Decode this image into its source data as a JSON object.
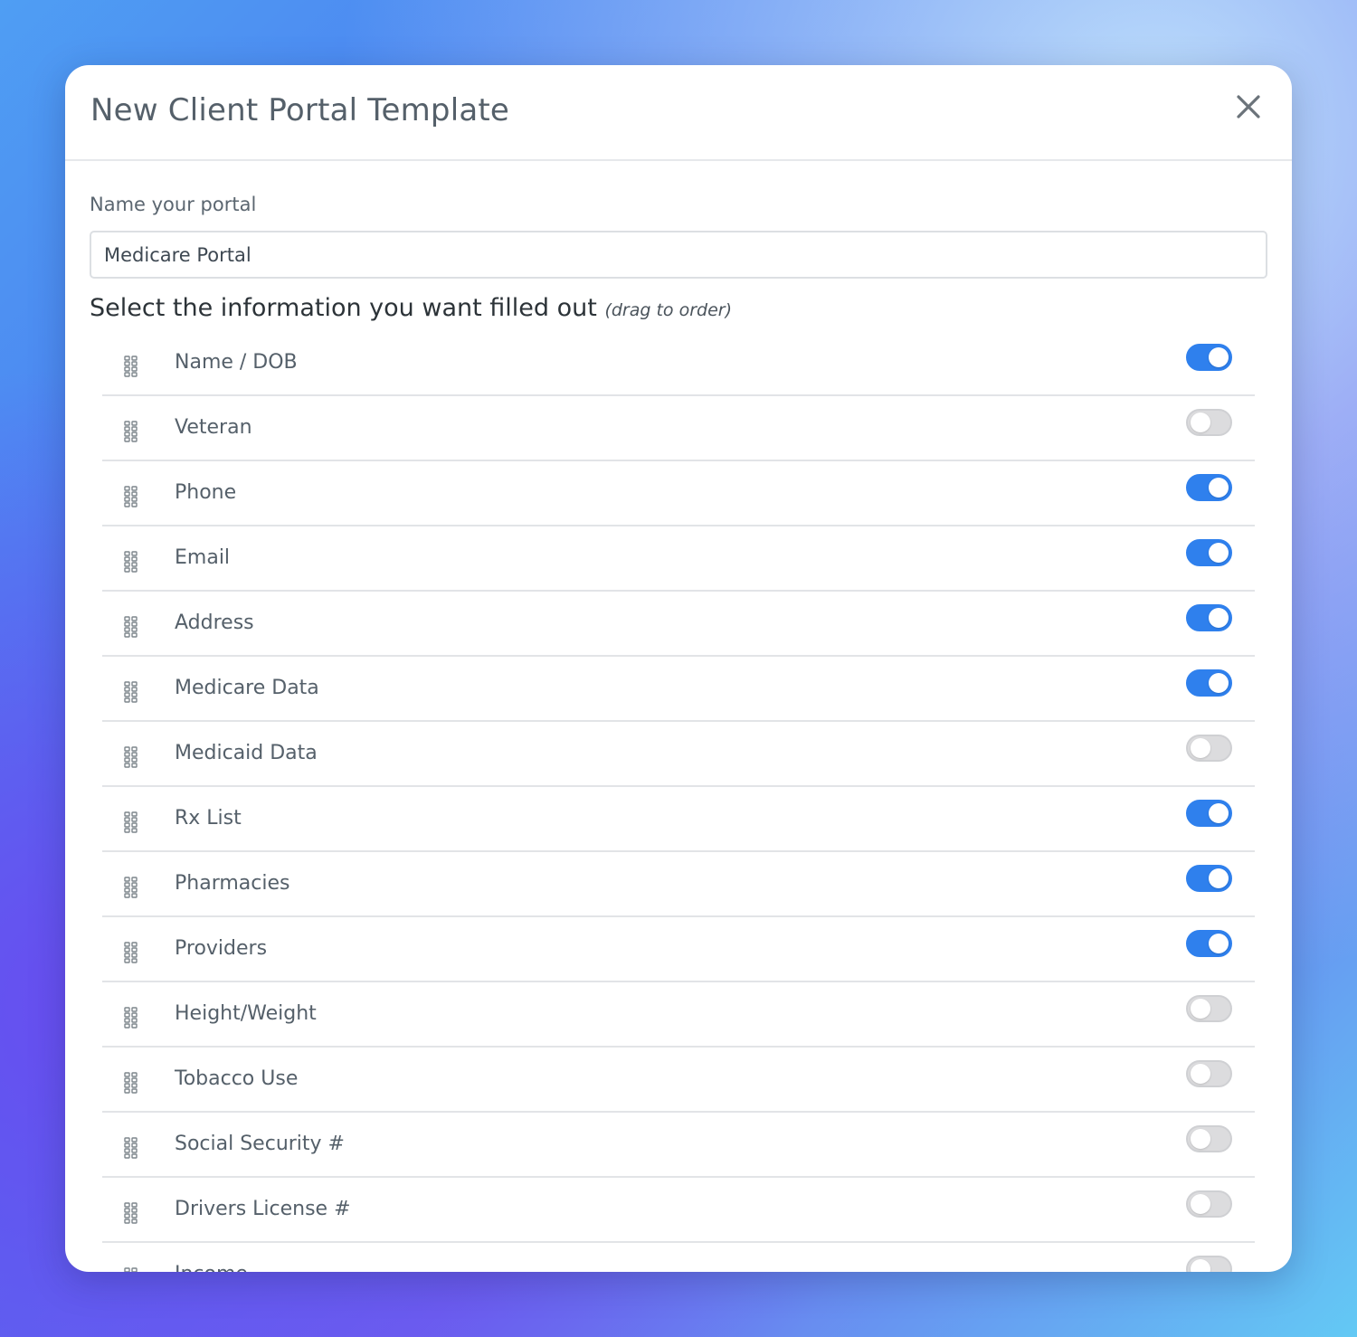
{
  "modal": {
    "title": "New Client Portal Template",
    "close_icon": "close-icon"
  },
  "form": {
    "name_label": "Name your portal",
    "name_value": "Medicare Portal",
    "section_heading": "Select the information you want filled out",
    "section_hint": "(drag to order)"
  },
  "colors": {
    "toggle_on": "#2f80ed",
    "toggle_off": "#dcdcde"
  },
  "options": [
    {
      "label": "Name / DOB",
      "enabled": true
    },
    {
      "label": "Veteran",
      "enabled": false
    },
    {
      "label": "Phone",
      "enabled": true
    },
    {
      "label": "Email",
      "enabled": true
    },
    {
      "label": "Address",
      "enabled": true
    },
    {
      "label": "Medicare Data",
      "enabled": true
    },
    {
      "label": "Medicaid Data",
      "enabled": false
    },
    {
      "label": "Rx List",
      "enabled": true
    },
    {
      "label": "Pharmacies",
      "enabled": true
    },
    {
      "label": "Providers",
      "enabled": true
    },
    {
      "label": "Height/Weight",
      "enabled": false
    },
    {
      "label": "Tobacco Use",
      "enabled": false
    },
    {
      "label": "Social Security #",
      "enabled": false
    },
    {
      "label": "Drivers License #",
      "enabled": false
    },
    {
      "label": "Income",
      "enabled": false
    }
  ]
}
